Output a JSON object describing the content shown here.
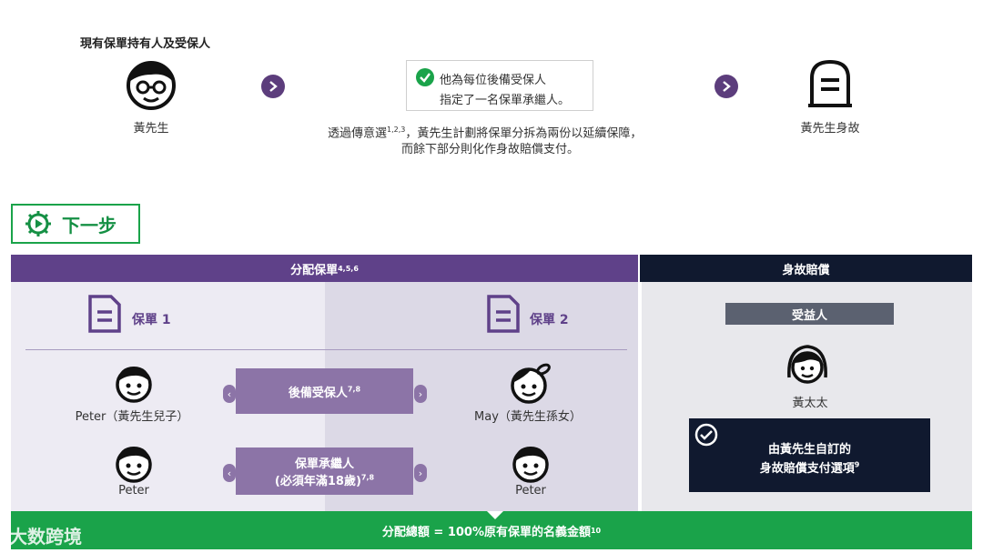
{
  "top": {
    "title": "現有保單持有人及受保人",
    "person_left": "黃先生",
    "note_line1": "他為每位後備受保人",
    "note_line2": "指定了一名保單承繼人。",
    "desc_line1": "透過傳意選",
    "desc_line1_sup": "1,2,3",
    "desc_line1_rest": "，黃先生計劃將保單分拆為兩份以延續保障，",
    "desc_line2": "而餘下部分則化作身故賠償支付。",
    "person_right": "黃先生身故"
  },
  "next_step": {
    "label": "下一步"
  },
  "allocation": {
    "header": "分配保單",
    "header_sup": "4,5,6",
    "policy1": "保單 1",
    "policy2": "保單 2",
    "backup_insured": "後備受保人",
    "backup_insured_sup": "7,8",
    "successor_line1": "保單承繼人",
    "successor_line2": "(必須年滿18歲)",
    "successor_sup": "7,8",
    "row1_left": "Peter（黃先生兒子）",
    "row1_right": "May（黃先生孫女）",
    "row2_left": "Peter",
    "row2_right": "Peter"
  },
  "death_benefit": {
    "header": "身故賠償",
    "beneficiary_label": "受益人",
    "beneficiary_name": "黃太太",
    "option_line1": "由黃先生自訂的",
    "option_line2": "身故賠償支付選項",
    "option_sup": "9"
  },
  "bottom": {
    "text": "分配總額 = 100%原有保單的名義金額",
    "sup": "10"
  },
  "watermark": "大数跨境",
  "colors": {
    "purple": "#5f4189",
    "navy": "#10192f",
    "green": "#1aa34a"
  }
}
